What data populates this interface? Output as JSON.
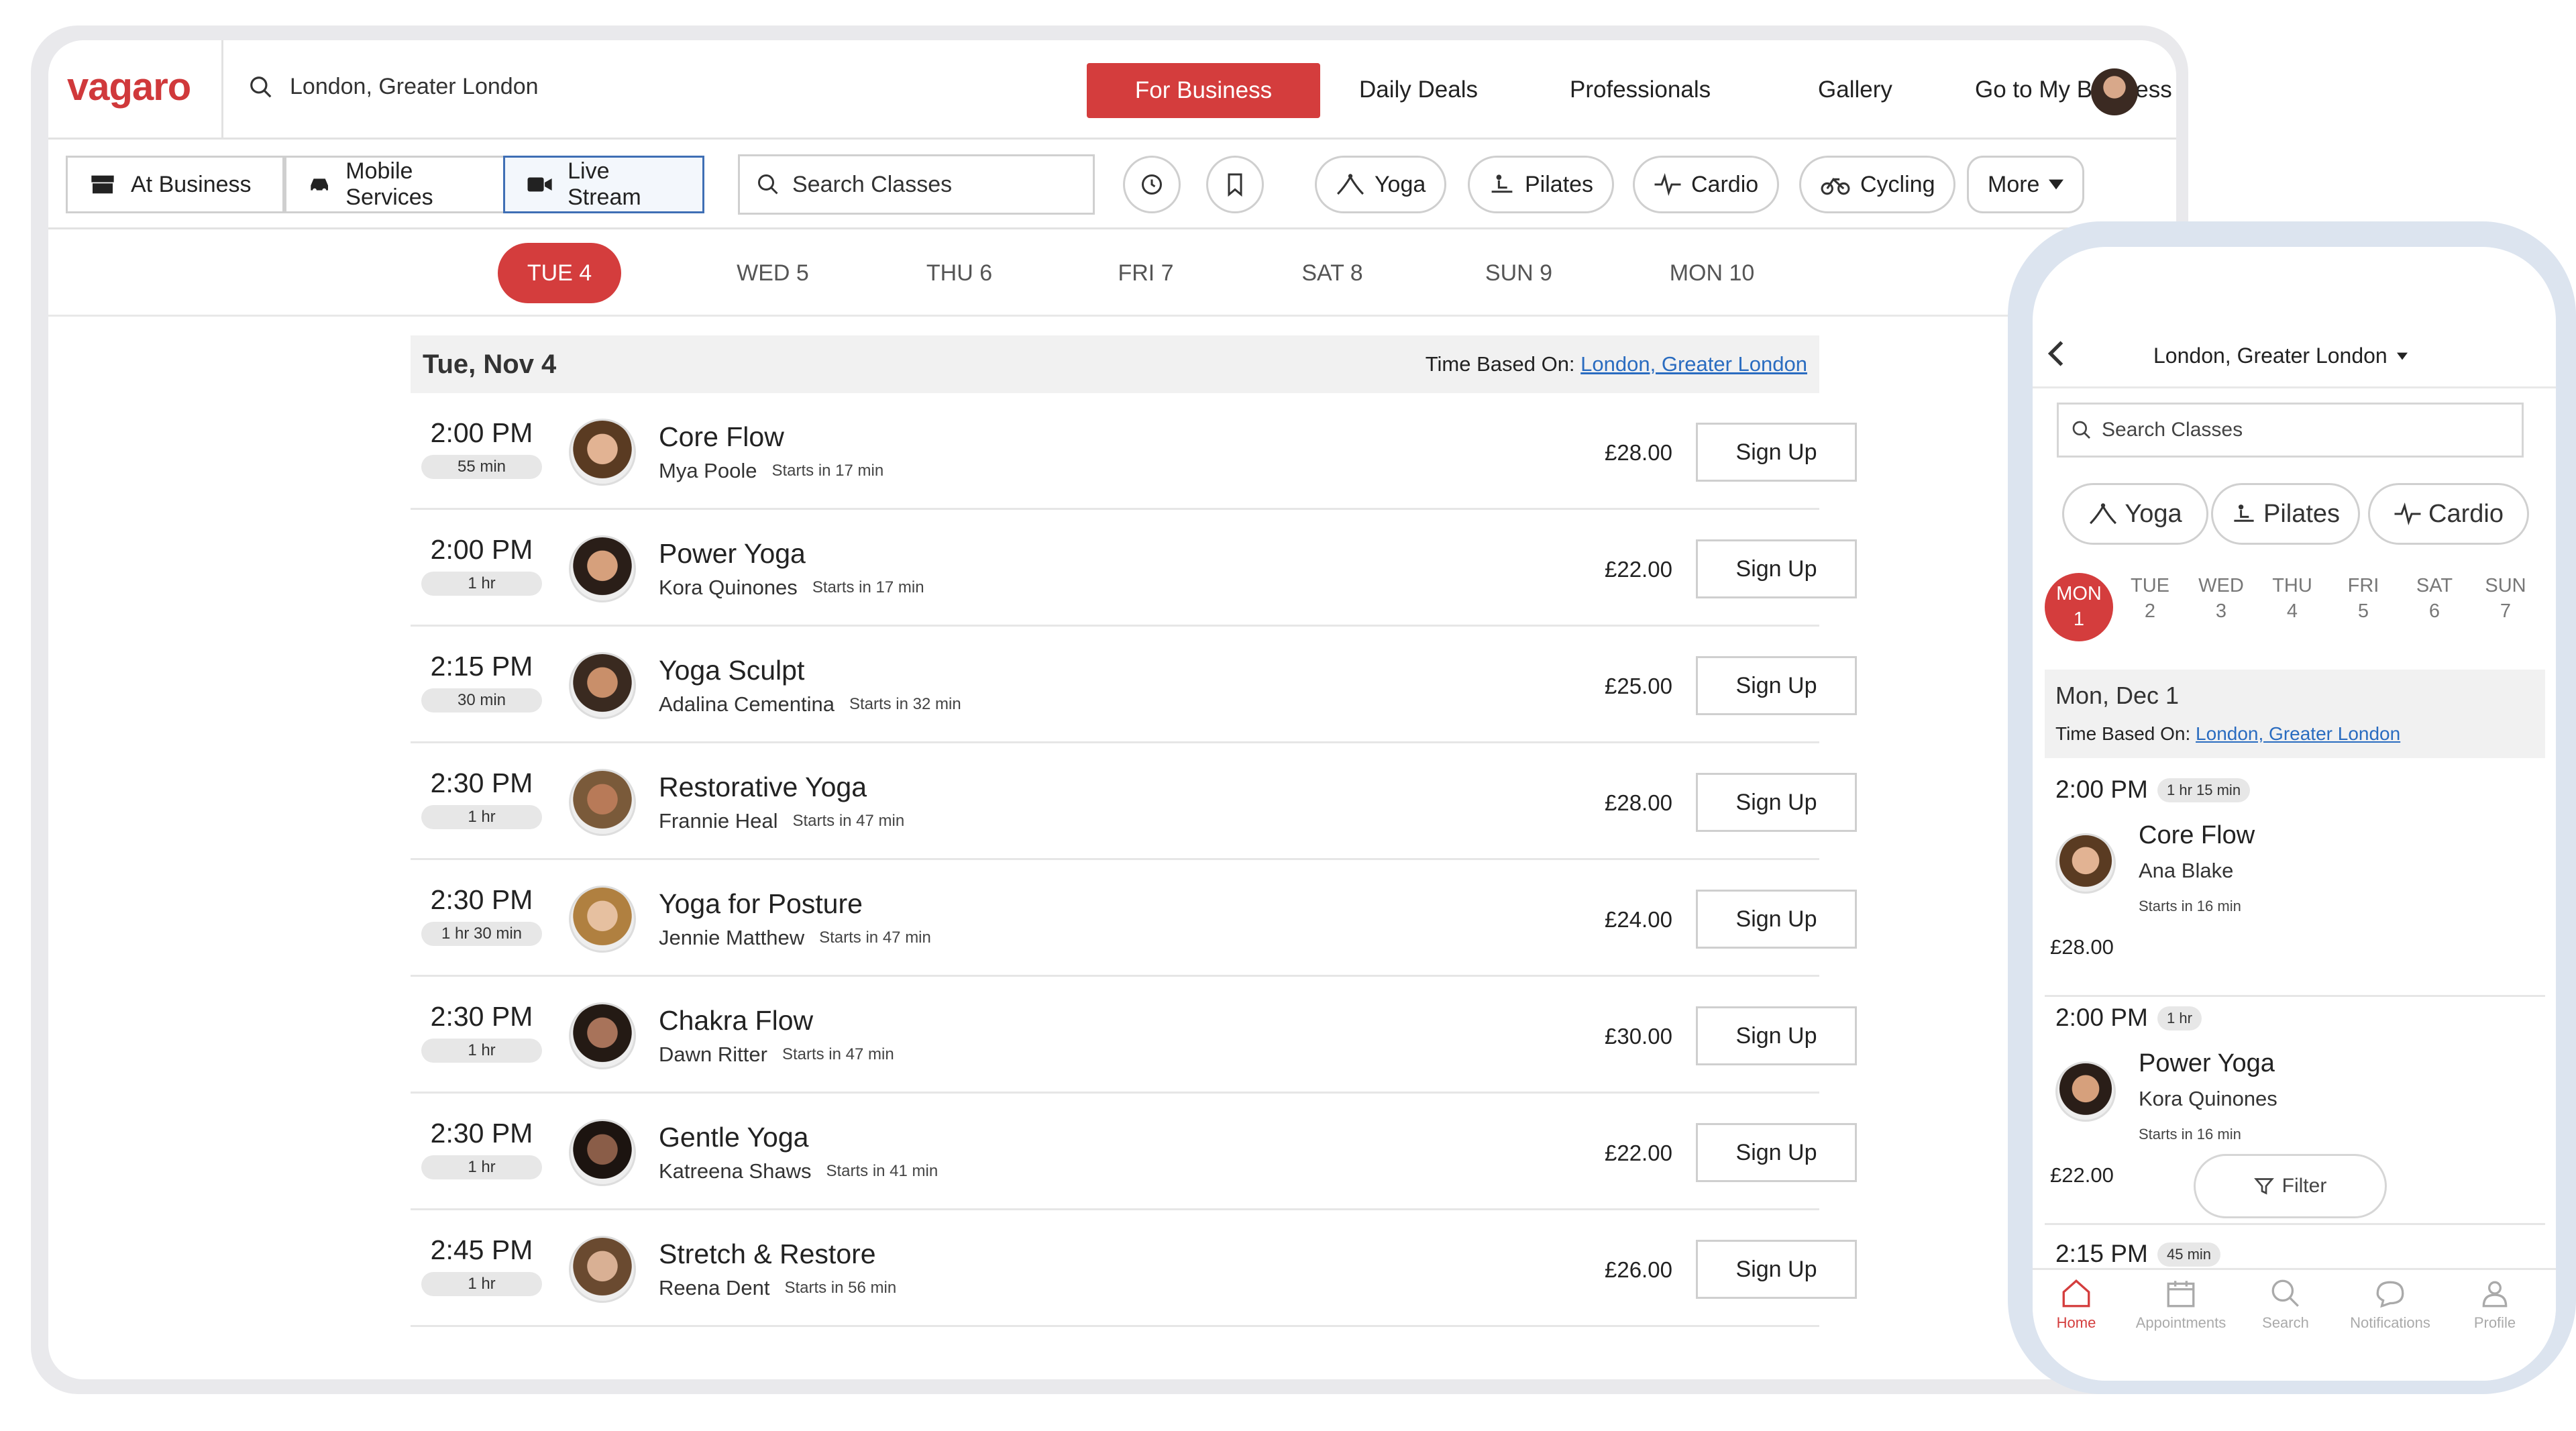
{
  "brand": {
    "logo": "vagaro",
    "accent": "#d43d3d"
  },
  "header": {
    "location": "London, Greater London",
    "for_business": "For Business",
    "nav": [
      "Daily Deals",
      "Professionals",
      "Gallery",
      "Go to My Business"
    ]
  },
  "filters": {
    "modes": [
      "At Business",
      "Mobile Services",
      "Live Stream"
    ],
    "active_mode": "Live Stream",
    "search_placeholder": "Search Classes",
    "categories": [
      "Yoga",
      "Pilates",
      "Cardio",
      "Cycling"
    ],
    "more": "More"
  },
  "days": [
    "TUE 4",
    "WED 5",
    "THU 6",
    "FRI 7",
    "SAT 8",
    "SUN 9",
    "MON 10"
  ],
  "selected_day": "TUE 4",
  "schedule": {
    "date": "Tue, Nov 4",
    "time_based_label": "Time Based On:",
    "time_based_link": "London, Greater London",
    "signup_label": "Sign Up",
    "classes": [
      {
        "time": "2:00 PM",
        "duration": "55 min",
        "name": "Core Flow",
        "instructor": "Mya Poole",
        "starts": "Starts in 17 min",
        "price": "£28.00"
      },
      {
        "time": "2:00 PM",
        "duration": "1 hr",
        "name": "Power Yoga",
        "instructor": "Kora Quinones",
        "starts": "Starts in 17 min",
        "price": "£22.00"
      },
      {
        "time": "2:15 PM",
        "duration": "30 min",
        "name": "Yoga Sculpt",
        "instructor": "Adalina Cementina",
        "starts": "Starts in 32 min",
        "price": "£25.00"
      },
      {
        "time": "2:30 PM",
        "duration": "1 hr",
        "name": "Restorative Yoga",
        "instructor": "Frannie Heal",
        "starts": "Starts in 47 min",
        "price": "£28.00"
      },
      {
        "time": "2:30 PM",
        "duration": "1 hr 30 min",
        "name": "Yoga for Posture",
        "instructor": "Jennie Matthew",
        "starts": "Starts in 47 min",
        "price": "£24.00"
      },
      {
        "time": "2:30 PM",
        "duration": "1 hr",
        "name": "Chakra Flow",
        "instructor": "Dawn Ritter",
        "starts": "Starts in 47 min",
        "price": "£30.00"
      },
      {
        "time": "2:30 PM",
        "duration": "1 hr",
        "name": "Gentle Yoga",
        "instructor": "Katreena Shaws",
        "starts": "Starts in 41 min",
        "price": "£22.00"
      },
      {
        "time": "2:45 PM",
        "duration": "1 hr",
        "name": "Stretch & Restore",
        "instructor": "Reena Dent",
        "starts": "Starts in 56 min",
        "price": "£26.00"
      }
    ]
  },
  "mobile": {
    "location": "London, Greater London",
    "search_placeholder": "Search Classes",
    "categories": [
      "Yoga",
      "Pilates",
      "Cardio"
    ],
    "days": [
      {
        "d": "MON",
        "n": "1"
      },
      {
        "d": "TUE",
        "n": "2"
      },
      {
        "d": "WED",
        "n": "3"
      },
      {
        "d": "THU",
        "n": "4"
      },
      {
        "d": "FRI",
        "n": "5"
      },
      {
        "d": "SAT",
        "n": "6"
      },
      {
        "d": "SUN",
        "n": "7"
      }
    ],
    "date": "Mon, Dec 1",
    "time_based_label": "Time Based On:",
    "time_based_link": "London, Greater London",
    "classes": [
      {
        "time": "2:00 PM",
        "duration": "1 hr 15 min",
        "name": "Core Flow",
        "instructor": "Ana Blake",
        "starts": "Starts in 16 min",
        "price": "£28.00"
      },
      {
        "time": "2:00 PM",
        "duration": "1 hr",
        "name": "Power Yoga",
        "instructor": "Kora Quinones",
        "starts": "Starts in 16 min",
        "price": "£22.00"
      },
      {
        "time": "2:15 PM",
        "duration": "45 min"
      }
    ],
    "filter_label": "Filter",
    "tabs": [
      "Home",
      "Appointments",
      "Search",
      "Notifications",
      "Profile"
    ]
  }
}
